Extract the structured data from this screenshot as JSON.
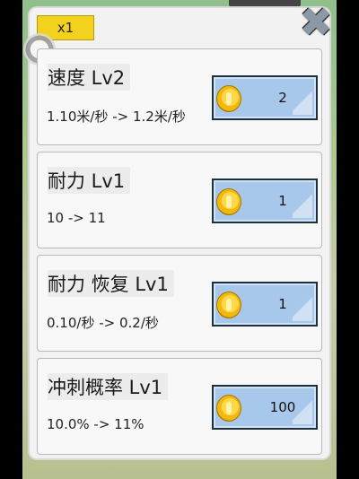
{
  "multiplier_label": "x1",
  "close_icon": "close-icon",
  "upgrades": [
    {
      "name": "速度 Lv2",
      "desc": "1.10米/秒 -> 1.2米/秒",
      "cost": "2"
    },
    {
      "name": "耐力 Lv1",
      "desc": "10 -> 11",
      "cost": "1"
    },
    {
      "name": "耐力 恢复 Lv1",
      "desc": "0.10/秒 -> 0.2/秒",
      "cost": "1"
    },
    {
      "name": "冲刺概率 Lv1",
      "desc": "10.0% -> 11%",
      "cost": "100"
    }
  ]
}
